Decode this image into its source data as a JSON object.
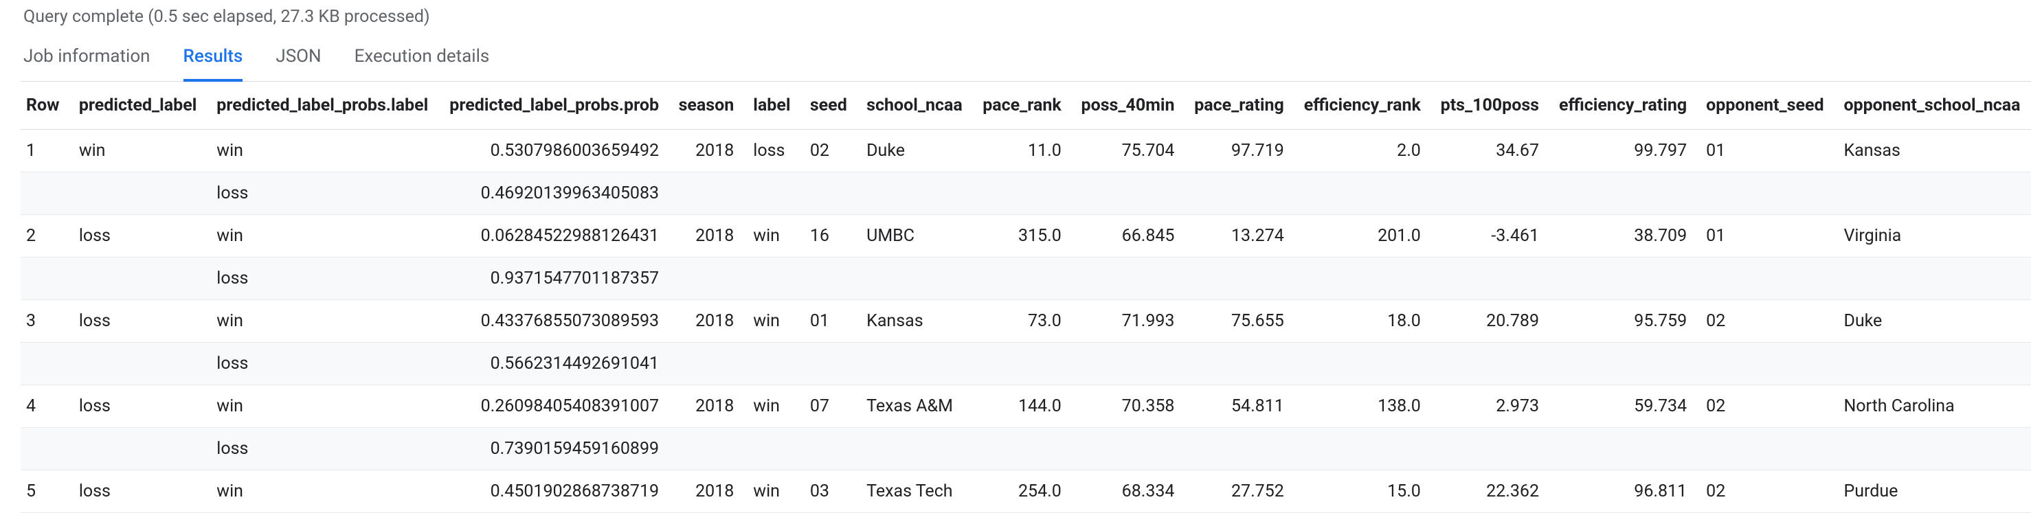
{
  "status": "Query complete (0.5 sec elapsed, 27.3 KB processed)",
  "tabs": [
    {
      "label": "Job information",
      "active": false
    },
    {
      "label": "Results",
      "active": true
    },
    {
      "label": "JSON",
      "active": false
    },
    {
      "label": "Execution details",
      "active": false
    }
  ],
  "columns": [
    {
      "key": "row",
      "label": "Row",
      "align": "left"
    },
    {
      "key": "predicted_label",
      "label": "predicted_label",
      "align": "left"
    },
    {
      "key": "predicted_label_probs_label",
      "label": "predicted_label_probs.label",
      "align": "left"
    },
    {
      "key": "predicted_label_probs_prob",
      "label": "predicted_label_probs.prob",
      "align": "right"
    },
    {
      "key": "season",
      "label": "season",
      "align": "right"
    },
    {
      "key": "label",
      "label": "label",
      "align": "left"
    },
    {
      "key": "seed",
      "label": "seed",
      "align": "left"
    },
    {
      "key": "school_ncaa",
      "label": "school_ncaa",
      "align": "left"
    },
    {
      "key": "pace_rank",
      "label": "pace_rank",
      "align": "right"
    },
    {
      "key": "poss_40min",
      "label": "poss_40min",
      "align": "right"
    },
    {
      "key": "pace_rating",
      "label": "pace_rating",
      "align": "right"
    },
    {
      "key": "efficiency_rank",
      "label": "efficiency_rank",
      "align": "right"
    },
    {
      "key": "pts_100poss",
      "label": "pts_100poss",
      "align": "right"
    },
    {
      "key": "efficiency_rating",
      "label": "efficiency_rating",
      "align": "right"
    },
    {
      "key": "opponent_seed",
      "label": "opponent_seed",
      "align": "left"
    },
    {
      "key": "opponent_school_ncaa",
      "label": "opponent_school_ncaa",
      "align": "left"
    }
  ],
  "rows": [
    {
      "row": "1",
      "predicted_label": "win",
      "probs": [
        {
          "label": "win",
          "prob": "0.5307986003659492"
        },
        {
          "label": "loss",
          "prob": "0.46920139963405083"
        }
      ],
      "season": "2018",
      "label": "loss",
      "seed": "02",
      "school_ncaa": "Duke",
      "pace_rank": "11.0",
      "poss_40min": "75.704",
      "pace_rating": "97.719",
      "efficiency_rank": "2.0",
      "pts_100poss": "34.67",
      "efficiency_rating": "99.797",
      "opponent_seed": "01",
      "opponent_school_ncaa": "Kansas"
    },
    {
      "row": "2",
      "predicted_label": "loss",
      "probs": [
        {
          "label": "win",
          "prob": "0.06284522988126431"
        },
        {
          "label": "loss",
          "prob": "0.9371547701187357"
        }
      ],
      "season": "2018",
      "label": "win",
      "seed": "16",
      "school_ncaa": "UMBC",
      "pace_rank": "315.0",
      "poss_40min": "66.845",
      "pace_rating": "13.274",
      "efficiency_rank": "201.0",
      "pts_100poss": "-3.461",
      "efficiency_rating": "38.709",
      "opponent_seed": "01",
      "opponent_school_ncaa": "Virginia"
    },
    {
      "row": "3",
      "predicted_label": "loss",
      "probs": [
        {
          "label": "win",
          "prob": "0.43376855073089593"
        },
        {
          "label": "loss",
          "prob": "0.5662314492691041"
        }
      ],
      "season": "2018",
      "label": "win",
      "seed": "01",
      "school_ncaa": "Kansas",
      "pace_rank": "73.0",
      "poss_40min": "71.993",
      "pace_rating": "75.655",
      "efficiency_rank": "18.0",
      "pts_100poss": "20.789",
      "efficiency_rating": "95.759",
      "opponent_seed": "02",
      "opponent_school_ncaa": "Duke"
    },
    {
      "row": "4",
      "predicted_label": "loss",
      "probs": [
        {
          "label": "win",
          "prob": "0.26098405408391007"
        },
        {
          "label": "loss",
          "prob": "0.7390159459160899"
        }
      ],
      "season": "2018",
      "label": "win",
      "seed": "07",
      "school_ncaa": "Texas A&M",
      "pace_rank": "144.0",
      "poss_40min": "70.358",
      "pace_rating": "54.811",
      "efficiency_rank": "138.0",
      "pts_100poss": "2.973",
      "efficiency_rating": "59.734",
      "opponent_seed": "02",
      "opponent_school_ncaa": "North Carolina"
    },
    {
      "row": "5",
      "predicted_label": "loss",
      "probs": [
        {
          "label": "win",
          "prob": "0.4501902868738719"
        }
      ],
      "season": "2018",
      "label": "win",
      "seed": "03",
      "school_ncaa": "Texas Tech",
      "pace_rank": "254.0",
      "poss_40min": "68.334",
      "pace_rating": "27.752",
      "efficiency_rank": "15.0",
      "pts_100poss": "22.362",
      "efficiency_rating": "96.811",
      "opponent_seed": "02",
      "opponent_school_ncaa": "Purdue"
    }
  ]
}
